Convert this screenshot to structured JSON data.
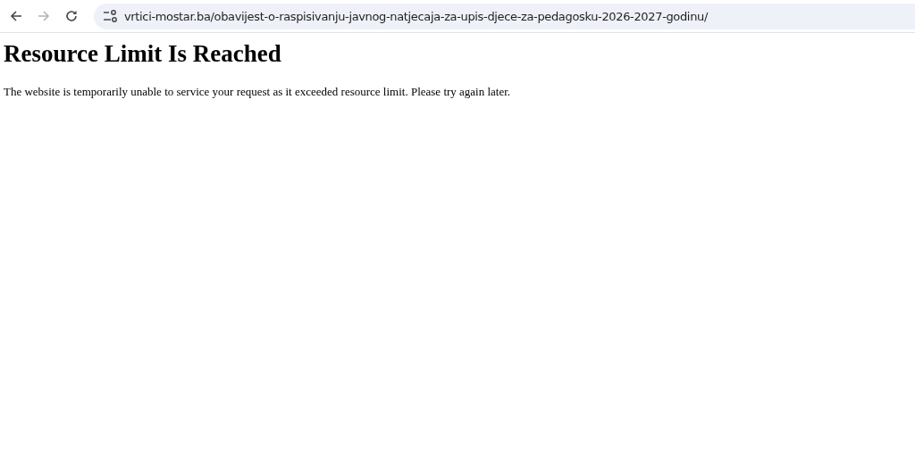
{
  "toolbar": {
    "back": {
      "disabled": false
    },
    "forward": {
      "disabled": true
    },
    "address": "vrtici-mostar.ba/obavijest-o-raspisivanju-javnog-natjecaja-za-upis-djece-za-pedagosku-2026-2027-godinu/"
  },
  "page": {
    "heading": "Resource Limit Is Reached",
    "message": "The website is temporarily unable to service your request as it exceeded resource limit. Please try again later."
  }
}
